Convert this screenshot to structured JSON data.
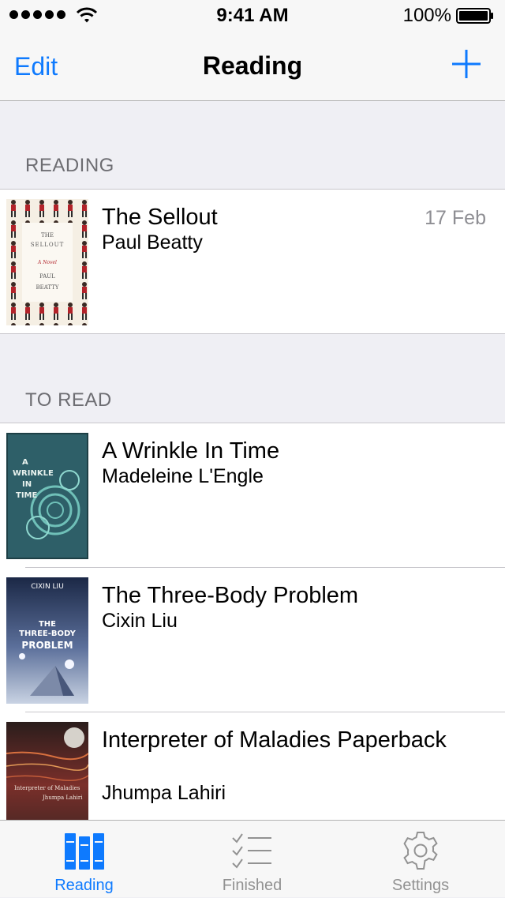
{
  "status_bar": {
    "time": "9:41 AM",
    "battery": "100%"
  },
  "nav": {
    "edit_label": "Edit",
    "title": "Reading",
    "add_icon": "plus-icon"
  },
  "sections": [
    {
      "title": "READING",
      "books": [
        {
          "title": "The Sellout",
          "author": "Paul Beatty",
          "date": "17 Feb",
          "cover_text": [
            "THE",
            "SELLOUT",
            "A Novel",
            "PAUL",
            "BEATTY"
          ]
        }
      ]
    },
    {
      "title": "TO READ",
      "books": [
        {
          "title": "A Wrinkle In Time",
          "author": "Madeleine L'Engle",
          "cover_text": [
            "A",
            "WRINKLE",
            "IN",
            "TIME"
          ]
        },
        {
          "title": "The Three-Body Problem",
          "author": "Cixin Liu",
          "cover_text": [
            "CIXIN LIU",
            "THE",
            "THREE-BODY",
            "PROBLEM"
          ]
        },
        {
          "title": "Interpreter of Maladies Paperback",
          "author": "Jhumpa Lahiri",
          "cover_text": [
            "Interpreter of Maladies",
            "Jhumpa Lahiri"
          ]
        }
      ]
    }
  ],
  "tabs": [
    {
      "label": "Reading",
      "icon": "books-icon",
      "active": true
    },
    {
      "label": "Finished",
      "icon": "checklist-icon",
      "active": false
    },
    {
      "label": "Settings",
      "icon": "gear-icon",
      "active": false
    }
  ],
  "colors": {
    "accent": "#0e7afe",
    "inactive": "#929292",
    "section_text": "#6d6d72",
    "background": "#efeff4"
  }
}
